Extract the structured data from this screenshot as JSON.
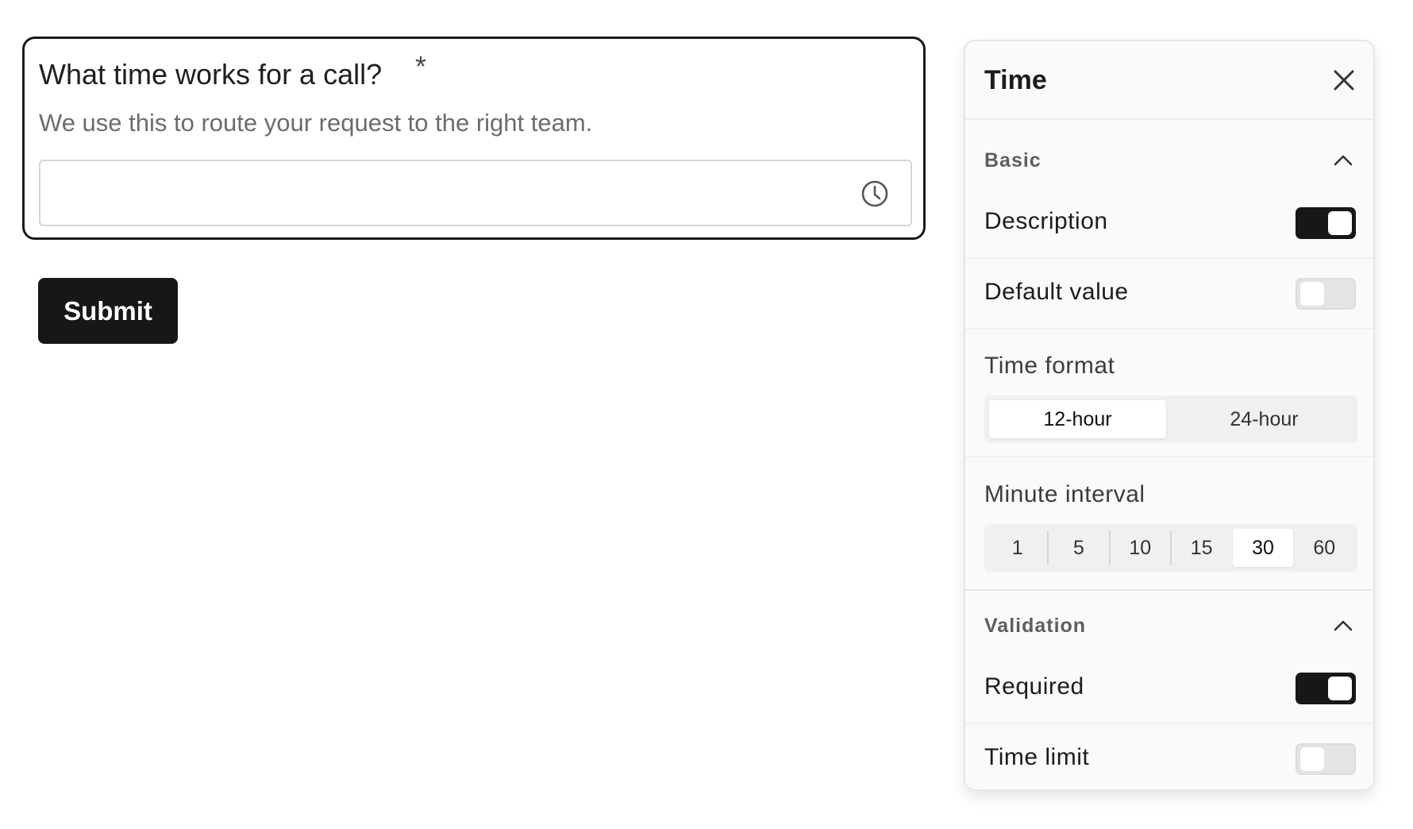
{
  "form": {
    "question": "What time works for a call?",
    "required_mark": "*",
    "description": "We use this to route your request to the right team.",
    "time_value": "",
    "input_icon": "clock-icon",
    "submit_label": "Submit"
  },
  "panel": {
    "title": "Time",
    "close_icon": "close-icon",
    "basic": {
      "label": "Basic",
      "expanded": true,
      "description": {
        "label": "Description",
        "enabled": true
      },
      "default_value": {
        "label": "Default value",
        "enabled": false
      },
      "time_format": {
        "label": "Time format",
        "options": [
          "12-hour",
          "24-hour"
        ],
        "selected": "12-hour"
      },
      "minute_interval": {
        "label": "Minute interval",
        "options": [
          "1",
          "5",
          "10",
          "15",
          "30",
          "60"
        ],
        "selected": "30"
      }
    },
    "validation": {
      "label": "Validation",
      "expanded": true,
      "required": {
        "label": "Required",
        "enabled": true
      },
      "time_limit": {
        "label": "Time limit",
        "enabled": false
      }
    }
  },
  "colors": {
    "primary": "#171717",
    "panel_bg": "#fafafa",
    "toggle_off": "#e4e4e4",
    "muted_text": "#6c6c6c"
  }
}
